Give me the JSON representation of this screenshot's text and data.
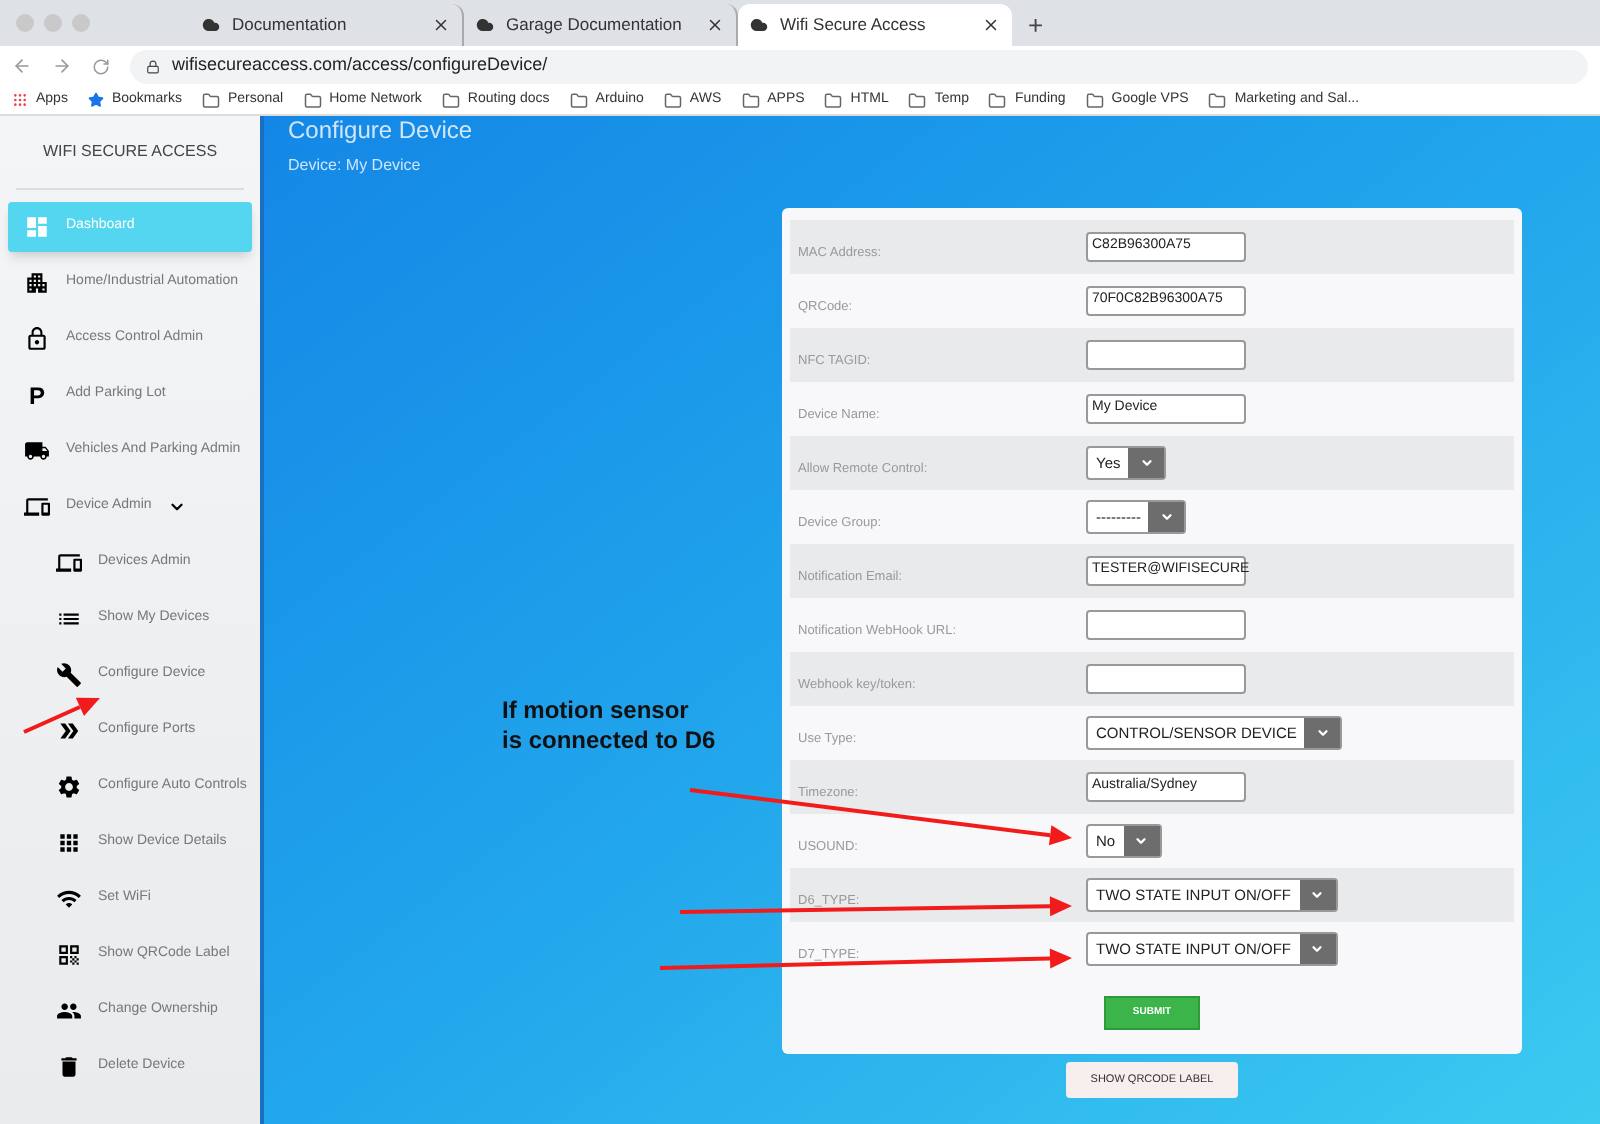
{
  "browser": {
    "tabs": [
      {
        "title": "Documentation",
        "selected": false
      },
      {
        "title": "Garage Documentation",
        "selected": false
      },
      {
        "title": "Wifi Secure Access",
        "selected": true
      }
    ],
    "new_tab": "+",
    "url": "wifisecureaccess.com/access/configureDevice/",
    "bookmarks": [
      {
        "label": "Apps",
        "kind": "apps"
      },
      {
        "label": "Bookmarks",
        "kind": "star"
      },
      {
        "label": "Personal",
        "kind": "folder"
      },
      {
        "label": "Home Network",
        "kind": "folder"
      },
      {
        "label": "Routing docs",
        "kind": "folder"
      },
      {
        "label": "Arduino",
        "kind": "folder"
      },
      {
        "label": "AWS",
        "kind": "folder"
      },
      {
        "label": "APPS",
        "kind": "folder"
      },
      {
        "label": "HTML",
        "kind": "folder"
      },
      {
        "label": "Temp",
        "kind": "folder"
      },
      {
        "label": "Funding",
        "kind": "folder"
      },
      {
        "label": "Google VPS",
        "kind": "folder"
      },
      {
        "label": "Marketing and Sal...",
        "kind": "folder"
      }
    ]
  },
  "sidebar": {
    "brand": "WIFI SECURE ACCESS",
    "items": [
      {
        "label": "Dashboard",
        "kind": "dashboard",
        "selected": true
      },
      {
        "label": "Home/Industrial Automation",
        "kind": "building",
        "selected": false
      },
      {
        "label": "Access Control Admin",
        "kind": "lock",
        "selected": false
      },
      {
        "label": "Add Parking Lot",
        "kind": "glyph",
        "glyph": "P",
        "selected": false
      },
      {
        "label": "Vehicles And Parking Admin",
        "kind": "truck",
        "selected": false
      },
      {
        "label": "Device Admin",
        "kind": "device",
        "selected": false,
        "expanded": true,
        "children": [
          {
            "label": "Devices Admin",
            "kind": "device",
            "selected": false
          },
          {
            "label": "Show My Devices",
            "kind": "list",
            "selected": false
          },
          {
            "label": "Configure Device",
            "kind": "wrench",
            "selected": false
          },
          {
            "label": "Configure Ports",
            "kind": "port",
            "selected": false
          },
          {
            "label": "Configure Auto Controls",
            "kind": "gear",
            "selected": false
          },
          {
            "label": "Show Device Details",
            "kind": "grid",
            "selected": false
          },
          {
            "label": "Set WiFi",
            "kind": "wifi",
            "selected": false
          },
          {
            "label": "Show QRCode Label",
            "kind": "qr",
            "selected": false
          },
          {
            "label": "Change Ownership",
            "kind": "users",
            "selected": false
          },
          {
            "label": "Delete Device",
            "kind": "trash",
            "selected": false
          }
        ]
      }
    ]
  },
  "page": {
    "title": "Configure Device",
    "subtitle": "Device: My Device"
  },
  "form": {
    "fields": [
      {
        "label": "MAC Address:",
        "kind": "text",
        "value": "C82B96300A75"
      },
      {
        "label": "QRCode:",
        "kind": "text",
        "value": "70F0C82B96300A75"
      },
      {
        "label": "NFC TAGID:",
        "kind": "text"
      },
      {
        "label": "Device Name:",
        "kind": "text",
        "value": "My Device"
      },
      {
        "label": "Allow Remote Control:",
        "kind": "select",
        "value": "Yes"
      },
      {
        "label": "Device Group:",
        "kind": "select",
        "value": "---------"
      },
      {
        "label": "Notification Email:",
        "kind": "text",
        "value": "TESTER@WIFISECURE"
      },
      {
        "label": "Notification WebHook URL:",
        "kind": "text"
      },
      {
        "label": "Webhook key/token:",
        "kind": "text"
      },
      {
        "label": "Use Type:",
        "kind": "select",
        "value": "CONTROL/SENSOR DEVICE"
      },
      {
        "label": "Timezone:",
        "kind": "text",
        "value": "Australia/Sydney"
      },
      {
        "label": "USOUND:",
        "kind": "select",
        "value": "No"
      },
      {
        "label": "D6_TYPE:",
        "kind": "select",
        "value": "TWO STATE INPUT ON/OFF"
      },
      {
        "label": "D7_TYPE:",
        "kind": "select",
        "value": "TWO STATE INPUT ON/OFF"
      }
    ],
    "submit": "SUBMIT"
  },
  "qr_button": "SHOW QRCODE LABEL",
  "annotation": {
    "lines": [
      "If motion sensor",
      "is connected to D6"
    ]
  }
}
